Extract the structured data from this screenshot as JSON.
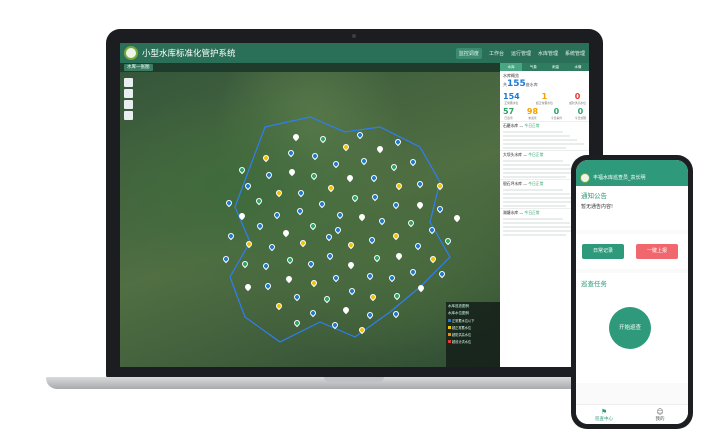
{
  "app": {
    "title": "小型水库标准化管护系统"
  },
  "nav": [
    "监控调度",
    "工作台",
    "运行管理",
    "水库管理",
    "系统管理"
  ],
  "tab": {
    "label": "水库一张图"
  },
  "panel": {
    "tabs": [
      "水库",
      "气象",
      "雨量",
      "水情"
    ],
    "section_title": "水库概览",
    "total": "155",
    "total_unit": "座水库",
    "stats_row1": [
      {
        "n": "154",
        "l": "正常蓄水位",
        "c": "#1f7bd1"
      },
      {
        "n": "1",
        "l": "超正常蓄水位",
        "c": "#f2a100"
      },
      {
        "n": "0",
        "l": "超防洪高水位",
        "c": "#e53935"
      }
    ],
    "stats_row2": [
      {
        "n": "57",
        "l": "已巡查",
        "c": "#2ea36a"
      },
      {
        "n": "98",
        "l": "未巡查",
        "c": "#f2a100"
      },
      {
        "n": "0",
        "l": "今日事件",
        "c": "#2ea36a"
      },
      {
        "n": "0",
        "l": "今日处理",
        "c": "#2ea36a"
      }
    ],
    "reservoirs": [
      {
        "name": "石磨水库",
        "status": "今日正常"
      },
      {
        "name": "大坝头水库",
        "status": "今日正常"
      },
      {
        "name": "银石坪水库",
        "status": "今日正常"
      },
      {
        "name": "湖塘水库",
        "status": "今日正常"
      }
    ]
  },
  "legend": {
    "h1": "水库巡查图例",
    "h2": "水库水位图例",
    "rows": [
      "正常蓄水位以下",
      "超正常蓄水位",
      "超防洪高水位",
      "超设计洪水位"
    ]
  },
  "phone": {
    "title": "丰福水库巡查员_袁长明",
    "notice_title": "通知公告",
    "notice_body": "暂无通告内容!",
    "btn_daily": "日常记录",
    "btn_report": "一键上报",
    "task_title": "巡查任务",
    "start": "开始巡查",
    "nav_work": "巡查中心",
    "nav_me": "我的"
  }
}
